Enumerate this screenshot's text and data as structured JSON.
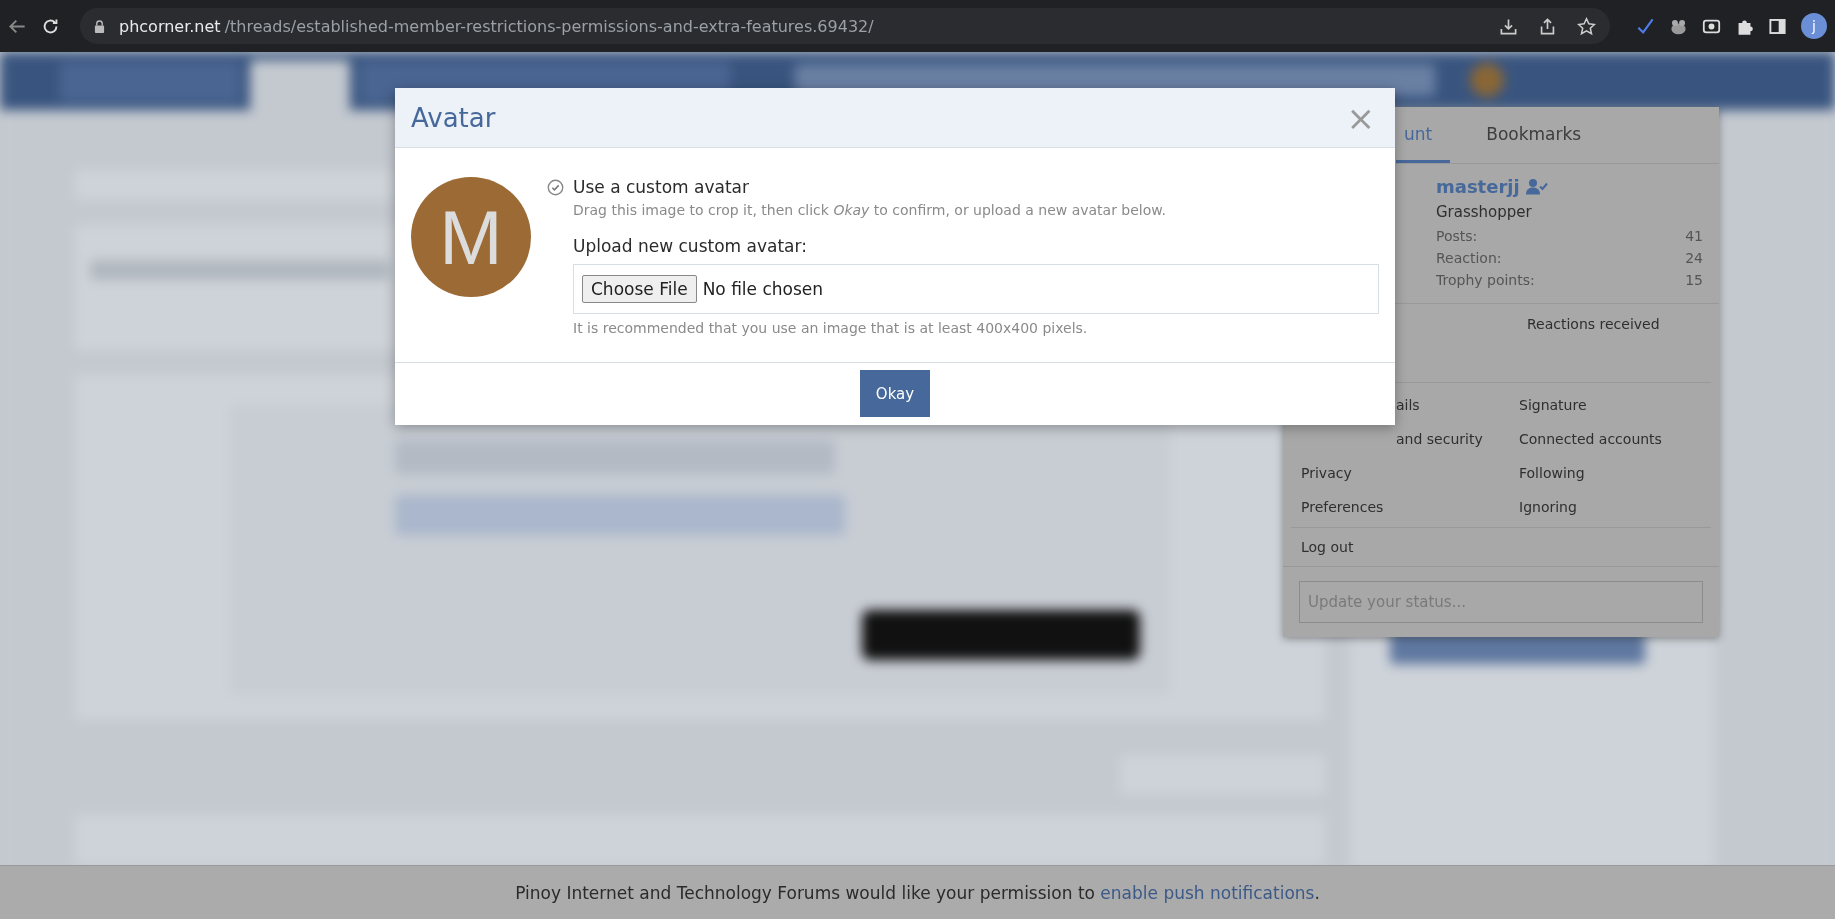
{
  "browser": {
    "url_host": "phcorner.net",
    "url_path": "/threads/established-member-restrictions-permissions-and-extra-features.69432/",
    "profile_initial": "j"
  },
  "modal": {
    "title": "Avatar",
    "close": "×",
    "avatar_letter": "M",
    "option": {
      "label": "Use a custom avatar",
      "checked": true
    },
    "hint": "Drag this image to crop it, then click *Okay* to confirm, or upload a new avatar below.",
    "upload_label": "Upload new custom avatar:",
    "choose_button": "Choose File",
    "file_status": "No file chosen",
    "recommendation": "It is recommended that you use an image that is at least 400x400 pixels.",
    "okay_button": "Okay"
  },
  "account_panel": {
    "tabs": [
      {
        "label": "unt",
        "selected": true
      },
      {
        "label": "Bookmarks",
        "selected": false
      }
    ],
    "user": {
      "name": "masterjj",
      "title": "Grasshopper",
      "stats": [
        {
          "label": "Posts:",
          "value": "41"
        },
        {
          "label": "Reaction:",
          "value": "24"
        },
        {
          "label": "Trophy points:",
          "value": "15"
        }
      ]
    },
    "top_links": [
      {
        "label": "Reactions received",
        "kind": "right"
      }
    ],
    "links": [
      {
        "label": "ails",
        "kind": "cut"
      },
      {
        "label": "Signature",
        "kind": "full"
      },
      {
        "label": "and security",
        "kind": "cut"
      },
      {
        "label": "Connected accounts",
        "kind": "full"
      },
      {
        "label": "Privacy",
        "kind": "full"
      },
      {
        "label": "Following",
        "kind": "full"
      },
      {
        "label": "Preferences",
        "kind": "full"
      },
      {
        "label": "Ignoring",
        "kind": "full"
      }
    ],
    "logout": "Log out",
    "status_placeholder": "Update your status..."
  },
  "notice": {
    "text": "Pinoy Internet and Technology Forums would like your permission to ",
    "link": "enable push notifications",
    "end": "."
  }
}
